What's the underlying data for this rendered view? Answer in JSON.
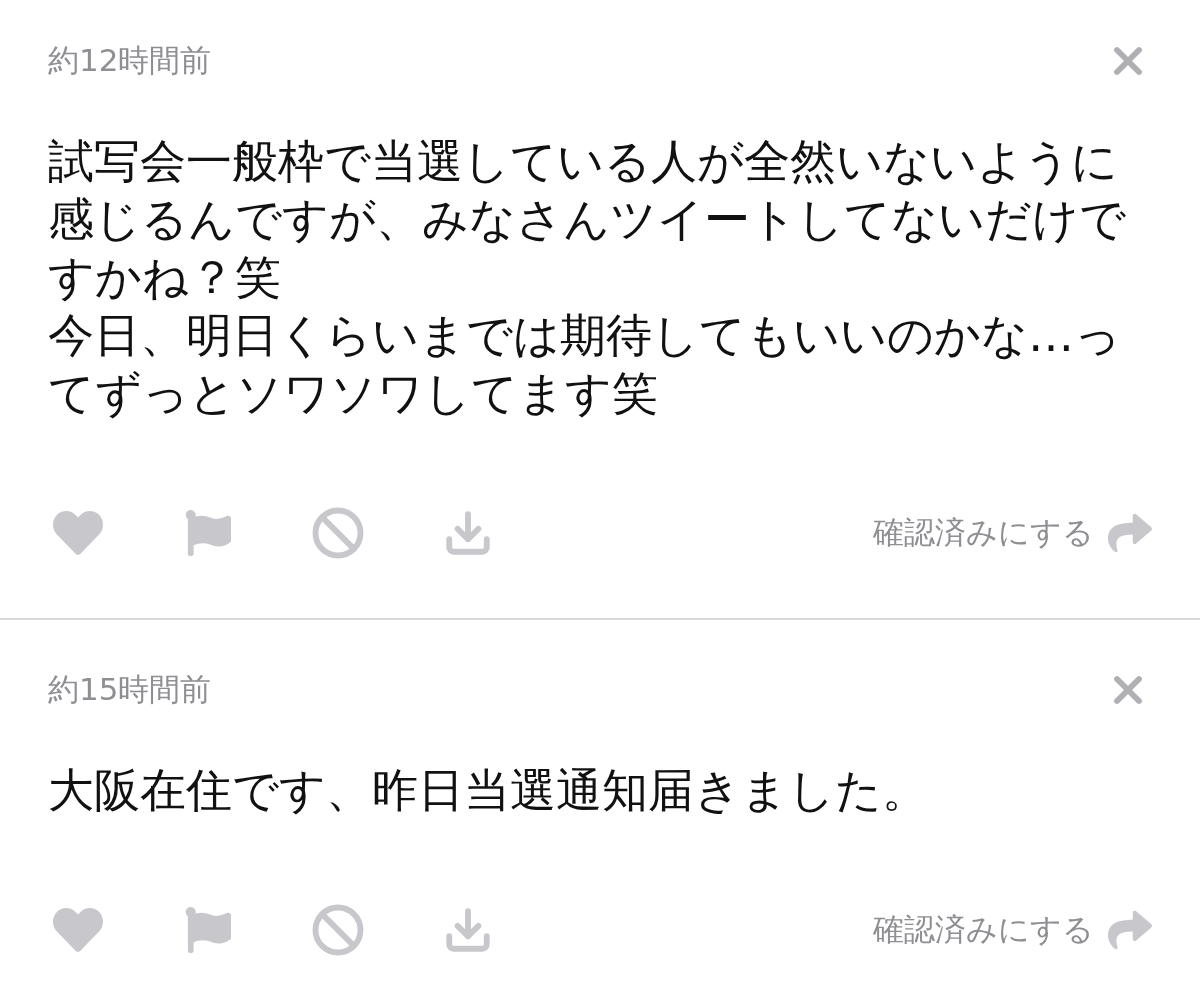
{
  "comments": [
    {
      "time": "約12時間前",
      "paragraphs": [
        "試写会一般枠で当選している人が全然いないように感じるんですが、みなさんツイートしてないだけですかね？笑",
        "今日、明日くらいまでは期待してもいいのかな…ってずっとソワソワしてます笑"
      ],
      "mark_read_label": "確認済みにする"
    },
    {
      "time": "約15時間前",
      "paragraphs": [
        "大阪在住です、昨日当選通知届きました。"
      ],
      "mark_read_label": "確認済みにする"
    }
  ]
}
